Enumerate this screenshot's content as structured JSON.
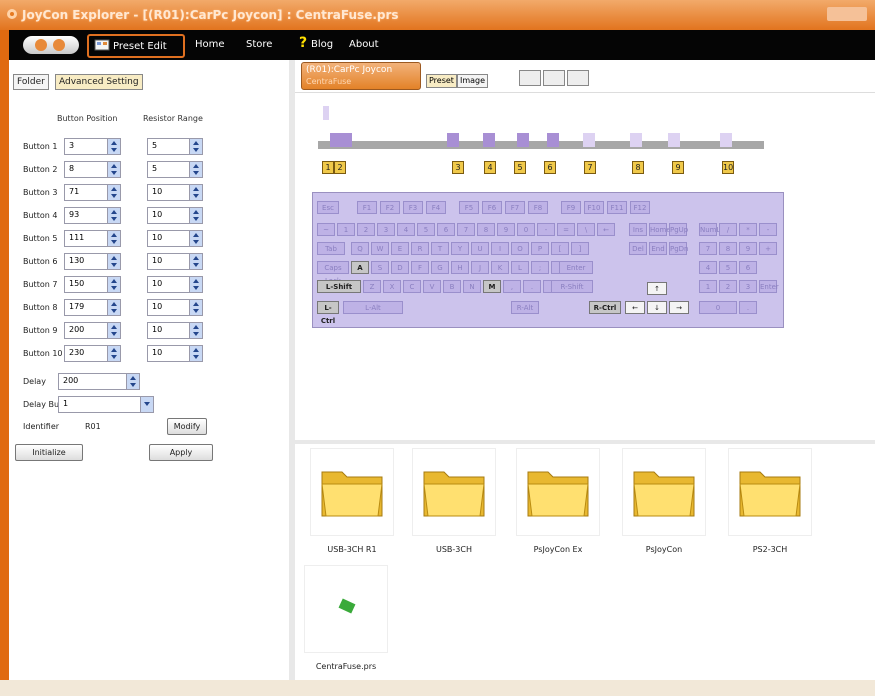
{
  "window": {
    "title": "JoyCon Explorer - [(R01):CarPc Joycon] : CentraFuse.prs"
  },
  "menu": {
    "preset_edit": "Preset Edit",
    "home": "Home",
    "store": "Store",
    "blog": "Blog",
    "about": "About"
  },
  "left": {
    "tabs": [
      "Folder",
      "Advanced Setting"
    ],
    "col_button_position": "Button Position",
    "col_resistor_range": "Resistor Range",
    "buttons": [
      {
        "label": "Button 1",
        "pos": "3",
        "range": "5"
      },
      {
        "label": "Button 2",
        "pos": "8",
        "range": "5"
      },
      {
        "label": "Button 3",
        "pos": "71",
        "range": "10"
      },
      {
        "label": "Button 4",
        "pos": "93",
        "range": "10"
      },
      {
        "label": "Button 5",
        "pos": "111",
        "range": "10"
      },
      {
        "label": "Button 6",
        "pos": "130",
        "range": "10"
      },
      {
        "label": "Button 7",
        "pos": "150",
        "range": "10"
      },
      {
        "label": "Button 8",
        "pos": "179",
        "range": "10"
      },
      {
        "label": "Button 9",
        "pos": "200",
        "range": "10"
      },
      {
        "label": "Button 10",
        "pos": "230",
        "range": "10"
      }
    ],
    "delay_label": "Delay",
    "delay_value": "200",
    "delay_button_label": "Delay Button",
    "delay_button_value": "1",
    "identifier_label": "Identifier",
    "identifier_value": "R01",
    "modify": "Modify",
    "initialize": "Initialize",
    "apply": "Apply"
  },
  "device_tab": {
    "line1": "(R01):CarPc Joycon",
    "line2": "CentraFuse"
  },
  "view_tabs": [
    "Preset",
    "Image"
  ],
  "markers": [
    "1",
    "2",
    "3",
    "4",
    "5",
    "6",
    "7",
    "8",
    "9",
    "10"
  ],
  "keyboard": {
    "esc": "Esc",
    "f_keys": [
      "F1",
      "F2",
      "F3",
      "F4",
      "F5",
      "F6",
      "F7",
      "F8",
      "F9",
      "F10",
      "F11",
      "F12"
    ],
    "num_row": [
      "~",
      "1",
      "2",
      "3",
      "4",
      "5",
      "6",
      "7",
      "8",
      "9",
      "0",
      "-",
      "=",
      "\\",
      "←"
    ],
    "q_row": [
      "Tab",
      "Q",
      "W",
      "E",
      "R",
      "T",
      "Y",
      "U",
      "I",
      "O",
      "P",
      "[",
      "]"
    ],
    "a_row": [
      "Caps Lock",
      "A",
      "S",
      "D",
      "F",
      "G",
      "H",
      "J",
      "K",
      "L",
      ";",
      "'",
      "Enter"
    ],
    "z_row": [
      "L-Shift",
      "Z",
      "X",
      "C",
      "V",
      "B",
      "N",
      "M",
      ",",
      ".",
      "/",
      "R-Shift"
    ],
    "bottom_row": [
      "L-Ctrl",
      "L-Alt",
      "R-Alt",
      "R-Ctrl"
    ],
    "nav": [
      "Ins",
      "Home",
      "PgUp",
      "Del",
      "End",
      "PgDn"
    ],
    "arrows": [
      "↑",
      "←",
      "↓",
      "→"
    ],
    "numpad": [
      "NumLock",
      "/",
      "*",
      "-",
      "7",
      "8",
      "9",
      "+",
      "4",
      "5",
      "6",
      "1",
      "2",
      "3",
      "Enter",
      "0",
      "."
    ]
  },
  "files": [
    {
      "name": "USB-3CH R1",
      "type": "folder"
    },
    {
      "name": "USB-3CH",
      "type": "folder"
    },
    {
      "name": "PsJoyCon Ex",
      "type": "folder"
    },
    {
      "name": "PsJoyCon",
      "type": "folder"
    },
    {
      "name": "PS2-3CH",
      "type": "folder"
    },
    {
      "name": "CentraFuse.prs",
      "type": "preset"
    }
  ]
}
